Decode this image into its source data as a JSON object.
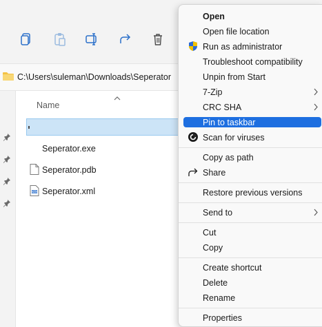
{
  "address": {
    "path": "C:\\Users\\suleman\\Downloads\\Seperator"
  },
  "file_list": {
    "column_name": "Name",
    "rename_value": "",
    "files": [
      {
        "name": "Seperator.exe",
        "icon": "exe-icon"
      },
      {
        "name": "Seperator.pdb",
        "icon": "document-icon"
      },
      {
        "name": "Seperator.xml",
        "icon": "xml-file-icon"
      }
    ]
  },
  "toolbar": {
    "buttons": [
      "copy-icon",
      "paste-icon",
      "rename-icon",
      "share-icon",
      "delete-icon"
    ]
  },
  "context_menu": {
    "items": [
      {
        "label": "Open",
        "bold": true
      },
      {
        "label": "Open file location"
      },
      {
        "label": "Run as administrator",
        "icon": "shield-icon"
      },
      {
        "label": "Troubleshoot compatibility"
      },
      {
        "label": "Unpin from Start"
      },
      {
        "label": "7-Zip",
        "submenu": true
      },
      {
        "label": "CRC SHA",
        "submenu": true
      },
      {
        "label": "Pin to taskbar",
        "highlighted": true
      },
      {
        "label": "Scan for viruses",
        "icon": "antivirus-icon"
      },
      {
        "label": "Copy as path"
      },
      {
        "label": "Share",
        "icon": "share-icon"
      },
      {
        "label": "Restore previous versions"
      },
      {
        "label": "Send to",
        "submenu": true
      },
      {
        "label": "Cut"
      },
      {
        "label": "Copy"
      },
      {
        "label": "Create shortcut"
      },
      {
        "label": "Delete"
      },
      {
        "label": "Rename"
      },
      {
        "label": "Properties"
      }
    ]
  },
  "colors": {
    "highlight": "#1e6fe0",
    "selection": "#cce4f7",
    "shield_blue": "#2b6bd6",
    "shield_yellow": "#f2c200"
  }
}
